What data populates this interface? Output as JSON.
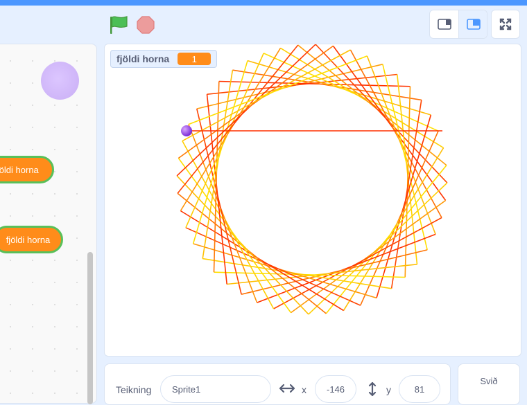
{
  "variable_monitor": {
    "label": "fjöldi horna",
    "value": "1"
  },
  "code_blocks": [
    {
      "label": "fjöldi horna"
    },
    {
      "label": "fjöldi horna"
    }
  ],
  "sprite_info": {
    "sprite_label": "Teikning",
    "sprite_name": "Sprite1",
    "x_label": "x",
    "x_value": "-146",
    "y_label": "y",
    "y_value": "81"
  },
  "stage_tab": {
    "label": "Svið"
  },
  "colors": {
    "accent": "#4c97ff",
    "variable_orange": "#ff8c1a",
    "pen_red": "#ff3000",
    "pen_yellow": "#ffe000"
  }
}
